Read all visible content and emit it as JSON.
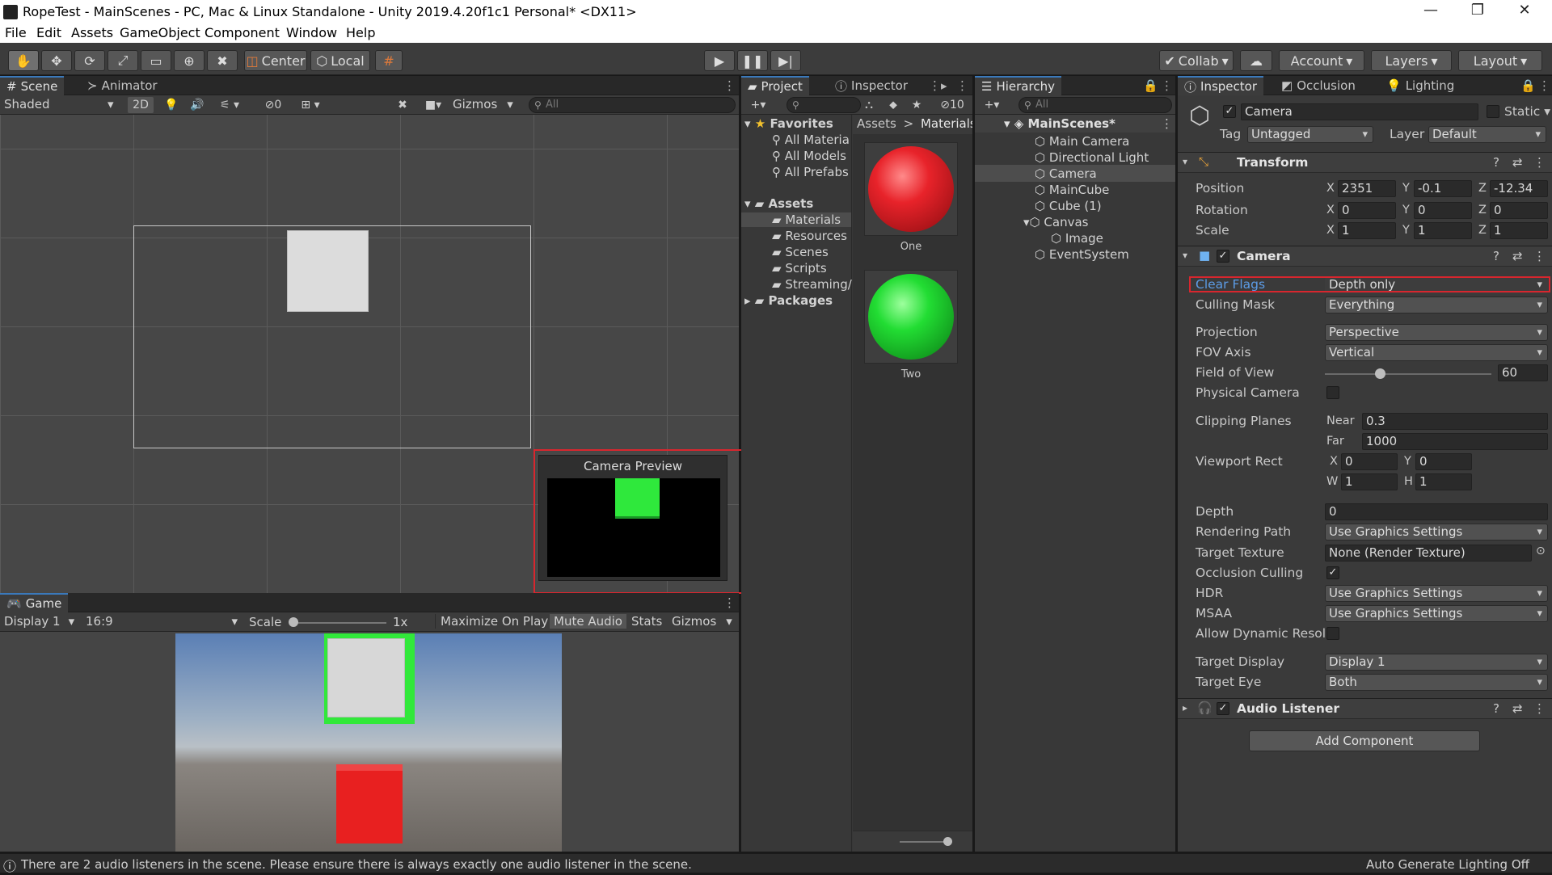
{
  "window": {
    "title": "RopeTest - MainScenes - PC, Mac & Linux Standalone - Unity 2019.4.20f1c1 Personal* <DX11>",
    "minimize": "—",
    "maximize": "❐",
    "close": "✕"
  },
  "menu": [
    "File",
    "Edit",
    "Assets",
    "GameObject",
    "Component",
    "Window",
    "Help"
  ],
  "toolbar": {
    "pivot": "Center",
    "space": "Local",
    "collab": "Collab",
    "account": "Account",
    "layers": "Layers",
    "layout": "Layout"
  },
  "scene": {
    "tab_scene": "Scene",
    "tab_animator": "Animator",
    "shading": "Shaded",
    "mode_2d": "2D",
    "hidden_count": "0",
    "gizmos": "Gizmos",
    "search_placeholder": "All",
    "camera_preview_title": "Camera Preview"
  },
  "game": {
    "tab": "Game",
    "display": "Display 1",
    "aspect": "16:9",
    "scale_label": "Scale",
    "scale_value": "1x",
    "maximize": "Maximize On Play",
    "mute": "Mute Audio",
    "stats": "Stats",
    "gizmos": "Gizmos"
  },
  "project": {
    "tab_project": "Project",
    "tab_inspector": "Inspector",
    "hidden_count": "10",
    "favorites_label": "Favorites",
    "favorites": [
      "All Materia",
      "All Models",
      "All Prefabs"
    ],
    "assets_label": "Assets",
    "asset_folders": [
      "Materials",
      "Resources",
      "Scenes",
      "Scripts",
      "Streaming/"
    ],
    "packages_label": "Packages",
    "breadcrumb_root": "Assets",
    "breadcrumb_sep": ">",
    "breadcrumb_current": "Materials",
    "materials": [
      {
        "name": "One",
        "color": "#e8232a"
      },
      {
        "name": "Two",
        "color": "#22dd33"
      }
    ]
  },
  "hierarchy": {
    "tab": "Hierarchy",
    "search_placeholder": "All",
    "scene_name": "MainScenes*",
    "items": [
      "Main Camera",
      "Directional Light",
      "Camera",
      "MainCube",
      "Cube (1)",
      "Canvas",
      "Image",
      "EventSystem"
    ]
  },
  "inspector": {
    "tab_inspector": "Inspector",
    "tab_occlusion": "Occlusion",
    "tab_lighting": "Lighting",
    "object_name": "Camera",
    "static_label": "Static",
    "tag_label": "Tag",
    "tag_value": "Untagged",
    "layer_label": "Layer",
    "layer_value": "Default",
    "transform": {
      "title": "Transform",
      "position_label": "Position",
      "rotation_label": "Rotation",
      "scale_label": "Scale",
      "position": {
        "x": "2351",
        "y": "-0.1",
        "z": "-12.34"
      },
      "rotation": {
        "x": "0",
        "y": "0",
        "z": "0"
      },
      "scale": {
        "x": "1",
        "y": "1",
        "z": "1"
      }
    },
    "camera": {
      "title": "Camera",
      "clear_flags_label": "Clear Flags",
      "clear_flags": "Depth only",
      "culling_mask_label": "Culling Mask",
      "culling_mask": "Everything",
      "projection_label": "Projection",
      "projection": "Perspective",
      "fov_axis_label": "FOV Axis",
      "fov_axis": "Vertical",
      "fov_label": "Field of View",
      "fov": "60",
      "fov_fraction": 0.33,
      "physical_label": "Physical Camera",
      "clipping_label": "Clipping Planes",
      "near_label": "Near",
      "near": "0.3",
      "far_label": "Far",
      "far": "1000",
      "viewport_label": "Viewport Rect",
      "vp_x": "0",
      "vp_y": "0",
      "vp_w": "1",
      "vp_h": "1",
      "depth_label": "Depth",
      "depth": "0",
      "rendering_path_label": "Rendering Path",
      "rendering_path": "Use Graphics Settings",
      "target_texture_label": "Target Texture",
      "target_texture": "None (Render Texture)",
      "occlusion_label": "Occlusion Culling",
      "hdr_label": "HDR",
      "hdr": "Use Graphics Settings",
      "msaa_label": "MSAA",
      "msaa": "Use Graphics Settings",
      "dynamic_res_label": "Allow Dynamic Resolu",
      "target_display_label": "Target Display",
      "target_display": "Display 1",
      "target_eye_label": "Target Eye",
      "target_eye": "Both"
    },
    "audio_listener": "Audio Listener",
    "add_component": "Add Component"
  },
  "statusbar": {
    "message": "There are 2 audio listeners in the scene. Please ensure there is always exactly one audio listener in the scene.",
    "right": "Auto Generate Lighting Off"
  }
}
